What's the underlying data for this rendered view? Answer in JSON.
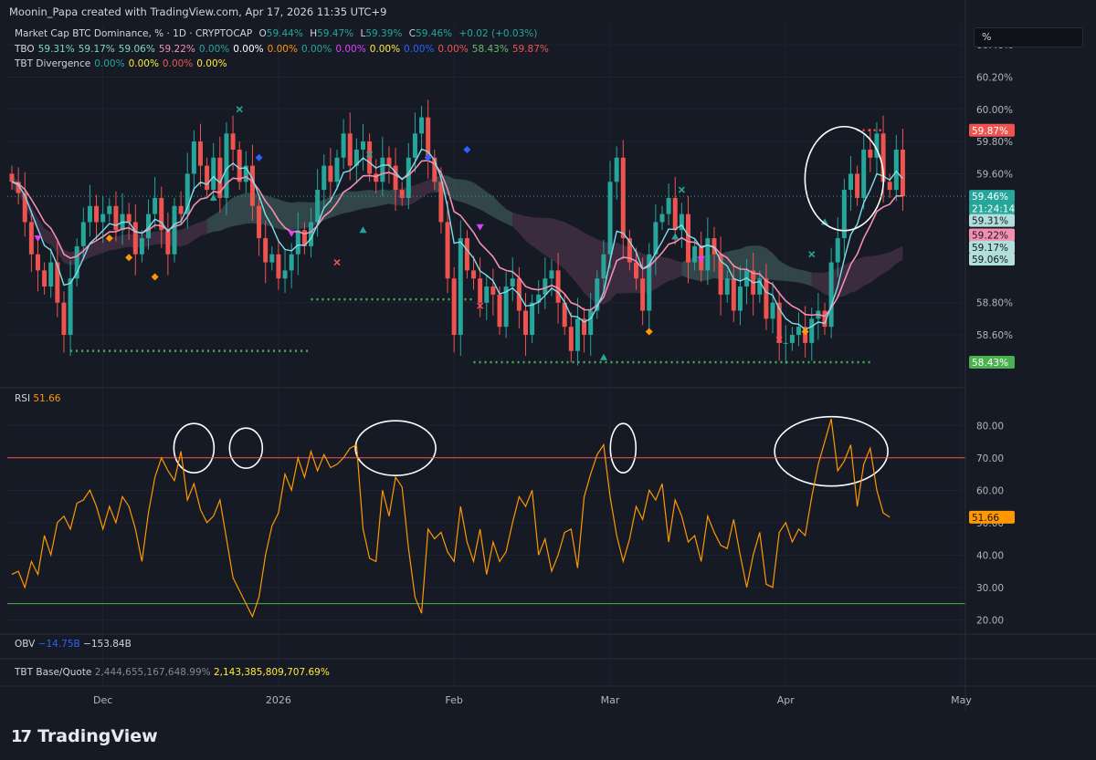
{
  "header": {
    "text": "Moonin_Papa created with TradingView.com, Apr 17, 2026 11:35 UTC+9"
  },
  "legend": {
    "main": {
      "title": "Market Cap BTC Dominance, % · 1D · CRYPTOCAP",
      "o_label": "O",
      "o": "59.44%",
      "h_label": "H",
      "h": "59.47%",
      "l_label": "L",
      "l": "59.39%",
      "c_label": "C",
      "c": "59.46%",
      "chg": "+0.02 (+0.03%)"
    },
    "tbo": {
      "label": "TBO",
      "values": [
        {
          "v": "59.31%",
          "color": "#7fd8c0"
        },
        {
          "v": "59.17%",
          "color": "#7fd8c0"
        },
        {
          "v": "59.06%",
          "color": "#7fd8c0"
        },
        {
          "v": "59.22%",
          "color": "#f48fb1"
        },
        {
          "v": "0.00%",
          "color": "#26a69a"
        },
        {
          "v": "0.00%",
          "color": "#ffffff"
        },
        {
          "v": "0.00%",
          "color": "#ff9800"
        },
        {
          "v": "0.00%",
          "color": "#26a69a"
        },
        {
          "v": "0.00%",
          "color": "#e040fb"
        },
        {
          "v": "0.00%",
          "color": "#ffeb3b"
        },
        {
          "v": "0.00%",
          "color": "#2962ff"
        },
        {
          "v": "0.00%",
          "color": "#ef5350"
        },
        {
          "v": "58.43%",
          "color": "#66bb6a"
        },
        {
          "v": "59.87%",
          "color": "#ef5350"
        }
      ]
    },
    "tbt": {
      "label": "TBT Divergence",
      "values": [
        {
          "v": "0.00%",
          "color": "#26a69a"
        },
        {
          "v": "0.00%",
          "color": "#ffeb3b"
        },
        {
          "v": "0.00%",
          "color": "#ef5350"
        },
        {
          "v": "0.00%",
          "color": "#ffeb3b"
        }
      ]
    },
    "rsi": {
      "label": "RSI",
      "value": "51.66"
    },
    "obv": {
      "label": "OBV",
      "v1": "−14.75B",
      "v2": "−153.84B"
    },
    "basequote": {
      "label": "TBT Base/Quote",
      "v1": "2,444,655,167,648.99%",
      "v2": "2,143,385,809,707.69%"
    }
  },
  "search": {
    "value": "%"
  },
  "price_badges": [
    {
      "text": "59.87%",
      "bg": "#ef5350",
      "fg": "#ffffff",
      "value": 59.87
    },
    {
      "text": "59.46%",
      "bg": "#26a69a",
      "fg": "#ffffff",
      "value": 59.46
    },
    {
      "text": "21:24:14",
      "bg": "#26a69a",
      "fg": "#ffffff",
      "value": 59.385
    },
    {
      "text": "59.31%",
      "bg": "#b2dfdb",
      "fg": "#131722",
      "value": 59.31
    },
    {
      "text": "59.22%",
      "bg": "#f48fb1",
      "fg": "#131722",
      "value": 59.22
    },
    {
      "text": "59.17%",
      "bg": "#b2dfdb",
      "fg": "#131722",
      "value": 59.145
    },
    {
      "text": "59.06%",
      "bg": "#b2dfdb",
      "fg": "#131722",
      "value": 59.07
    },
    {
      "text": "58.43%",
      "bg": "#4caf50",
      "fg": "#ffffff",
      "value": 58.43
    }
  ],
  "rsi_badge": {
    "text": "51.66",
    "bg": "#ff9800",
    "fg": "#131722",
    "value": 51.66
  },
  "branding": {
    "logo_text": "TradingView",
    "logo_mark": "17"
  },
  "chart_data": {
    "type": "candlestick",
    "price_axis": {
      "ticks": [
        "60.40%",
        "60.20%",
        "60.00%",
        "59.80%",
        "59.60%",
        "58.80%",
        "58.60%"
      ],
      "ylim": [
        58.3,
        60.52
      ]
    },
    "rsi_axis": {
      "ticks": [
        "80.00",
        "70.00",
        "60.00",
        "50.00",
        "40.00",
        "30.00",
        "20.00"
      ],
      "ylim": [
        17,
        86
      ],
      "overbought": 70,
      "oversold": 25
    },
    "x_ticks": [
      "Dec",
      "2026",
      "Feb",
      "Mar",
      "Apr",
      "May"
    ],
    "horizontal_levels": [
      {
        "value": 58.5,
        "from": "Nov 20",
        "to": "Jan 08",
        "color": "#4caf50"
      },
      {
        "value": 58.82,
        "from": "Jan 08",
        "to": "Feb 05",
        "color": "#4caf50"
      },
      {
        "value": 58.43,
        "from": "Feb 06",
        "to": "Apr 19",
        "color": "#4caf50"
      },
      {
        "value": 59.87,
        "from": "Apr 11",
        "to": "Apr 17",
        "color": "#ef5350"
      }
    ],
    "series": [
      {
        "name": "Close",
        "values": [
          59.55,
          59.48,
          59.3,
          59.1,
          59.0,
          58.9,
          59.05,
          58.8,
          58.6,
          58.95,
          59.15,
          59.3,
          59.4,
          59.3,
          59.35,
          59.4,
          59.25,
          59.35,
          59.3,
          59.1,
          59.2,
          59.35,
          59.45,
          59.25,
          59.1,
          59.4,
          59.35,
          59.6,
          59.8,
          59.65,
          59.5,
          59.7,
          59.45,
          59.85,
          59.75,
          59.55,
          59.65,
          59.4,
          59.2,
          59.05,
          59.1,
          58.95,
          59.0,
          59.1,
          59.25,
          59.15,
          59.3,
          59.5,
          59.65,
          59.55,
          59.7,
          59.85,
          59.65,
          59.75,
          59.8,
          59.6,
          59.55,
          59.7,
          59.65,
          59.5,
          59.45,
          59.7,
          59.85,
          59.95,
          59.7,
          59.55,
          59.3,
          58.95,
          58.6,
          59.2,
          59.0,
          58.95,
          58.8,
          58.9,
          58.85,
          58.65,
          58.9,
          58.95,
          58.75,
          58.6,
          58.8,
          58.85,
          58.95,
          59.0,
          58.8,
          58.65,
          58.5,
          58.7,
          58.6,
          58.75,
          58.95,
          59.1,
          59.55,
          59.7,
          59.2,
          59.05,
          58.95,
          58.75,
          59.1,
          59.3,
          59.35,
          59.45,
          59.25,
          59.35,
          59.05,
          59.15,
          59.0,
          59.2,
          59.1,
          58.85,
          58.95,
          58.75,
          58.9,
          59.0,
          58.85,
          58.95,
          58.7,
          58.8,
          58.55,
          58.55,
          58.6,
          58.65,
          58.55,
          58.7,
          58.75,
          58.65,
          59.05,
          59.2,
          59.5,
          59.6,
          59.45,
          59.75,
          59.7,
          59.85,
          59.55,
          59.5,
          59.75,
          59.46
        ]
      },
      {
        "name": "RSI",
        "values": [
          34,
          35,
          30,
          38,
          34,
          46,
          40,
          50,
          52,
          48,
          56,
          57,
          60,
          55,
          48,
          55,
          50,
          58,
          55,
          48,
          38,
          53,
          64,
          70,
          66,
          63,
          72,
          57,
          62,
          54,
          50,
          52,
          57,
          45,
          33,
          29,
          25,
          21,
          27,
          40,
          49,
          53,
          65,
          60,
          70,
          64,
          72,
          66,
          71,
          67,
          68,
          70,
          73,
          74,
          48,
          39,
          38,
          60,
          52,
          64,
          61,
          42,
          27,
          22,
          48,
          45,
          47,
          41,
          38,
          55,
          44,
          38,
          48,
          34,
          44,
          38,
          41,
          50,
          58,
          55,
          60,
          40,
          45,
          35,
          40,
          47,
          48,
          36,
          58,
          65,
          71,
          74,
          58,
          46,
          38,
          45,
          55,
          51,
          60,
          57,
          62,
          44,
          57,
          52,
          44,
          46,
          38,
          52,
          47,
          43,
          42,
          51,
          40,
          30,
          40,
          47,
          31,
          30,
          47,
          50,
          44,
          48,
          46,
          58,
          68,
          75,
          82,
          66,
          69,
          74,
          55,
          68,
          73,
          60,
          53,
          51.66
        ]
      }
    ]
  }
}
